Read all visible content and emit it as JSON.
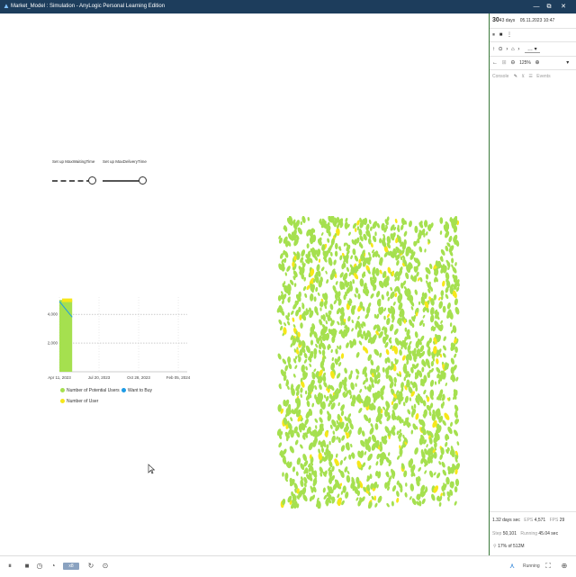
{
  "window": {
    "title": "Market_Model : Simulation - AnyLogic Personal Learning Edition",
    "minimize": "—",
    "restore": "⧉",
    "close": "✕"
  },
  "sliders": [
    {
      "label": "Set up MaxWaitingTime",
      "value_fraction": 1.0
    },
    {
      "label": "Set up MaxDeliveryTime",
      "value_fraction": 1.0
    }
  ],
  "chart_data": {
    "type": "area",
    "x_ticks": [
      "Apr 11, 2023",
      "Jul 20, 2023",
      "Oct 28, 2023",
      "Feb 05, 2024"
    ],
    "y_ticks": [
      "2,000",
      "4,000"
    ],
    "ylim": [
      0,
      5200
    ],
    "series": [
      {
        "name": "Number of Potential Users",
        "color": "#a5e04f",
        "x": [
          0,
          0.1
        ],
        "values": [
          5000,
          5000
        ]
      },
      {
        "name": "Want to Buy",
        "color": "#1e9be6",
        "x": [
          0,
          0.1
        ],
        "values": [
          4900,
          3800
        ]
      },
      {
        "name": "Number of User",
        "color": "#f6e71a",
        "x": [
          0,
          0.1
        ],
        "values": [
          0,
          0
        ]
      }
    ]
  },
  "side_panel": {
    "elapsed_num": "30",
    "elapsed_unit": "43 days",
    "date": "05.11.2023 10:47",
    "zoom": "125%",
    "tab_console": "Console",
    "tab_events": "Events",
    "stat_speed": "1.32 days sec",
    "stat_eps_label": "EPS",
    "stat_eps": "4,571",
    "stat_fps_label": "FPS",
    "stat_fps": "29",
    "stat_step_label": "Step",
    "stat_step": "50,101",
    "stat_running_label": "Running",
    "stat_running": "45.04 sec",
    "memory": "17% of 512M"
  },
  "status": {
    "speed_badge": "x8",
    "running": "Running"
  },
  "colors": {
    "agent_green": "#a5e04f",
    "agent_yellow": "#f6e71a",
    "titlebar": "#1d3d5c"
  }
}
